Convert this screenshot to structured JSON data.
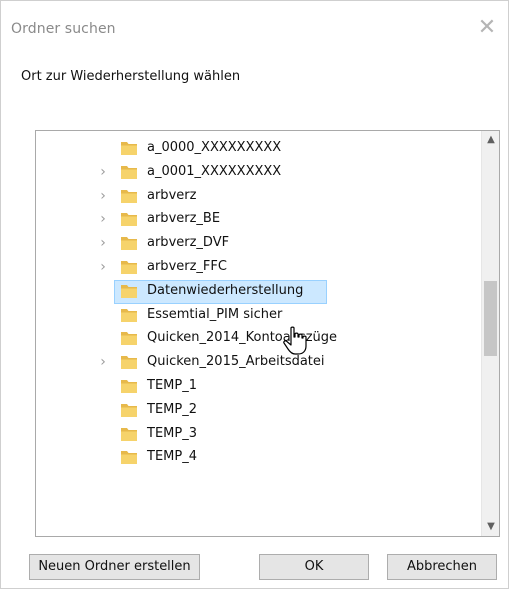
{
  "window": {
    "title": "Ordner suchen",
    "close_icon": "close-icon"
  },
  "prompt": "Ort zur Wiederherstellung wählen",
  "tree": {
    "items": [
      {
        "label": "a_0000_XXXXXXXXX",
        "expandable": false,
        "selected": false
      },
      {
        "label": "a_0001_XXXXXXXXX",
        "expandable": true,
        "selected": false
      },
      {
        "label": "arbverz",
        "expandable": true,
        "selected": false
      },
      {
        "label": "arbverz_BE",
        "expandable": true,
        "selected": false
      },
      {
        "label": "arbverz_DVF",
        "expandable": true,
        "selected": false
      },
      {
        "label": "arbverz_FFC",
        "expandable": true,
        "selected": false
      },
      {
        "label": "Datenwiederherstellung",
        "expandable": false,
        "selected": true
      },
      {
        "label": "Essemtial_PIM sicher",
        "expandable": false,
        "selected": false
      },
      {
        "label": "Quicken_2014_Kontoauszüge",
        "expandable": false,
        "selected": false
      },
      {
        "label": "Quicken_2015_Arbeitsdatei",
        "expandable": true,
        "selected": false
      },
      {
        "label": "TEMP_1",
        "expandable": false,
        "selected": false
      },
      {
        "label": "TEMP_2",
        "expandable": false,
        "selected": false
      },
      {
        "label": "TEMP_3",
        "expandable": false,
        "selected": false
      },
      {
        "label": "TEMP_4",
        "expandable": false,
        "selected": false
      }
    ],
    "folder_icon": "folder-icon",
    "expander_icon": "chevron-right-icon",
    "colors": {
      "folder": "#f6d36b",
      "folder_dark": "#e7b94b",
      "selection_bg": "#cce8ff",
      "selection_border": "#99d1ff"
    }
  },
  "scrollbar": {
    "up_icon": "chevron-up-icon",
    "down_icon": "chevron-down-icon"
  },
  "buttons": {
    "new_folder": "Neuen Ordner erstellen",
    "ok": "OK",
    "cancel": "Abbrechen"
  }
}
